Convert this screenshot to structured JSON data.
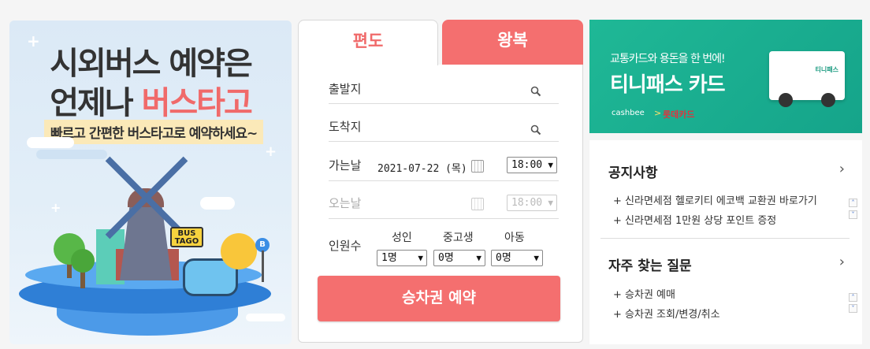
{
  "promo": {
    "title_line1": "시외버스 예약은",
    "title_line2_prefix": "언제나 ",
    "title_line2_accent": "버스타고",
    "subtitle": "빠르고 간편한 버스타고로 예약하세요~",
    "bus_sign": "BUS TAGO",
    "bus_stop": "B"
  },
  "tabs": {
    "oneway": "편도",
    "round": "왕복"
  },
  "form": {
    "departure_label": "출발지",
    "arrival_label": "도착지",
    "go_date_label": "가는날",
    "go_date_value": "2021-07-22 (목)",
    "go_time_value": "18:00",
    "return_date_label": "오는날",
    "return_time_value": "18:00",
    "passengers_label": "인원수",
    "adult_label": "성인",
    "adult_value": "1명",
    "student_label": "중고생",
    "student_value": "0명",
    "child_label": "아동",
    "child_value": "0명",
    "reserve_button": "승차권 예약"
  },
  "ad": {
    "subtitle": "교통카드와 용돈을 한 번에!",
    "title": "티니패스 카드",
    "brand1": "cashbee",
    "separator": ">",
    "brand2": "롯데카드",
    "card_label": "티니패스"
  },
  "notices": {
    "title": "공지사항",
    "items": [
      "+ 신라면세점 헬로키티 에코백 교환권 바로가기",
      "+ 신라면세점 1만원 상당 포인트 증정"
    ]
  },
  "faq": {
    "title": "자주 찾는 질문",
    "items": [
      "+ 승차권 예매",
      "+ 승차권 조회/변경/취소"
    ]
  },
  "colors": {
    "accent_red": "#f46f6f",
    "ad_green": "#1fb896"
  }
}
